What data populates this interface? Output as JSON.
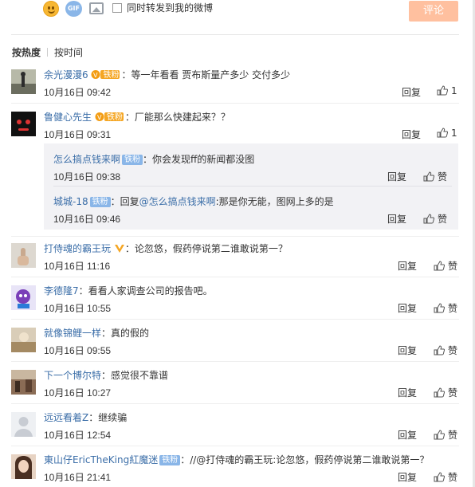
{
  "composer": {
    "repost_label": "同时转发到我的微博",
    "submit_label": "评论",
    "icons": [
      "emoji-icon",
      "gif-icon",
      "image-icon"
    ]
  },
  "sort": {
    "hot_label": "按热度",
    "time_label": "按时间"
  },
  "actions": {
    "reply_label": "回复",
    "like_label": "赞"
  },
  "fan_badge": "铁粉",
  "comments": [
    {
      "user": "余光漫漫6",
      "text": "：等一年看看 贾布斯量产多少 交付多少",
      "time": "10月16日 09:42",
      "likes": "1"
    },
    {
      "user": "鲁健心先生",
      "text": "：厂能那么快建起来？？",
      "time": "10月16日 09:31",
      "likes": "1"
    },
    {
      "user": "打侍魂的霸王玩",
      "text": "：论忽悠，假药停说第二谁敢说第一？",
      "time": "10月16日 11:16",
      "likes": ""
    },
    {
      "user": "李德隆7",
      "text": "：看看人家调查公司的报告吧。",
      "time": "10月16日 10:55",
      "likes": ""
    },
    {
      "user": "就像锦鲤一样",
      "text": "：真的假的",
      "time": "10月16日 09:55",
      "likes": ""
    },
    {
      "user": "下一个博尔特",
      "text": "：感觉很不靠谱",
      "time": "10月16日 10:27",
      "likes": ""
    },
    {
      "user": "远远看着Z",
      "text": "：继续骗",
      "time": "10月16日 12:54",
      "likes": ""
    },
    {
      "user": "東山仔EricTheKing紅魔迷",
      "text": "：//@打侍魂的霸王玩:论忽悠，假药停说第二谁敢说第一？",
      "time": "10月16日 21:41",
      "likes": ""
    }
  ],
  "replies": [
    {
      "user": "怎么搞点钱来啊",
      "text": "：你会发现ff的新闻都没图",
      "time": "10月16日 09:38"
    },
    {
      "user": "城城-18",
      "text": "：回复",
      "mention": "@怎么搞点钱来啊",
      "text2": ":那是你无能，图网上多的是",
      "time": "10月16日 09:46"
    }
  ],
  "colors": {
    "link": "#3b6ea8",
    "submit": "#ffc09f",
    "fan_badge": "#8ab6e8",
    "reply_box": "#f2f2f5"
  }
}
